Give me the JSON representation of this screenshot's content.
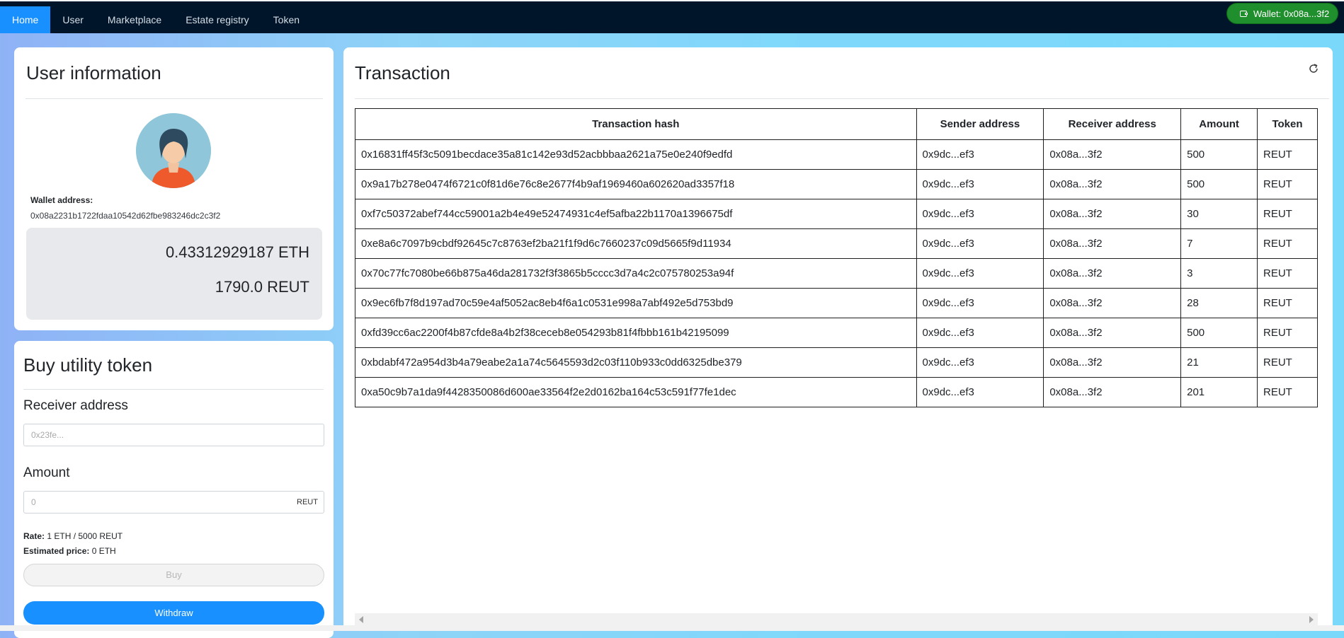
{
  "nav": {
    "items": [
      {
        "label": "Home",
        "active": true
      },
      {
        "label": "User"
      },
      {
        "label": "Marketplace"
      },
      {
        "label": "Estate registry"
      },
      {
        "label": "Token"
      }
    ],
    "wallet_button": "Wallet: 0x08a...3f2"
  },
  "user_info": {
    "title": "User information",
    "wallet_label": "Wallet address:",
    "wallet_address": "0x08a2231b1722fdaa10542d62fbe983246dc2c3f2",
    "eth_balance": "0.43312929187 ETH",
    "reut_balance": "1790.0 REUT"
  },
  "buy_token": {
    "title": "Buy utility token",
    "receiver_label": "Receiver address",
    "receiver_placeholder": "0x23fe...",
    "amount_label": "Amount",
    "amount_placeholder": "0",
    "amount_unit": "REUT",
    "rate_label": "Rate:",
    "rate_value": "1 ETH / 5000 REUT",
    "estimated_label": "Estimated price:",
    "estimated_value": "0 ETH",
    "buy_label": "Buy",
    "withdraw_label": "Withdraw"
  },
  "transactions": {
    "title": "Transaction",
    "columns": [
      "Transaction hash",
      "Sender address",
      "Receiver address",
      "Amount",
      "Token"
    ],
    "rows": [
      [
        "0x16831ff45f3c5091becdace35a81c142e93d52acbbbaa2621a75e0e240f9edfd",
        "0x9dc...ef3",
        "0x08a...3f2",
        "500",
        "REUT"
      ],
      [
        "0x9a17b278e0474f6721c0f81d6e76c8e2677f4b9af1969460a602620ad3357f18",
        "0x9dc...ef3",
        "0x08a...3f2",
        "500",
        "REUT"
      ],
      [
        "0xf7c50372abef744cc59001a2b4e49e52474931c4ef5afba22b1170a1396675df",
        "0x9dc...ef3",
        "0x08a...3f2",
        "30",
        "REUT"
      ],
      [
        "0xe8a6c7097b9cbdf92645c7c8763ef2ba21f1f9d6c7660237c09d5665f9d11934",
        "0x9dc...ef3",
        "0x08a...3f2",
        "7",
        "REUT"
      ],
      [
        "0x70c77fc7080be66b875a46da281732f3f3865b5cccc3d7a4c2c075780253a94f",
        "0x9dc...ef3",
        "0x08a...3f2",
        "3",
        "REUT"
      ],
      [
        "0x9ec6fb7f8d197ad70c59e4af5052ac8eb4f6a1c0531e998a7abf492e5d753bd9",
        "0x9dc...ef3",
        "0x08a...3f2",
        "28",
        "REUT"
      ],
      [
        "0xfd39cc6ac2200f4b87cfde8a4b2f38ceceb8e054293b81f4fbbb161b42195099",
        "0x9dc...ef3",
        "0x08a...3f2",
        "500",
        "REUT"
      ],
      [
        "0xbdabf472a954d3b4a79eabe2a1a74c5645593d2c03f110b933c0dd6325dbe379",
        "0x9dc...ef3",
        "0x08a...3f2",
        "21",
        "REUT"
      ],
      [
        "0xa50c9b7a1da9f4428350086d600ae33564f2e2d0162ba164c53c591f77fe1dec",
        "0x9dc...ef3",
        "0x08a...3f2",
        "201",
        "REUT"
      ]
    ]
  }
}
